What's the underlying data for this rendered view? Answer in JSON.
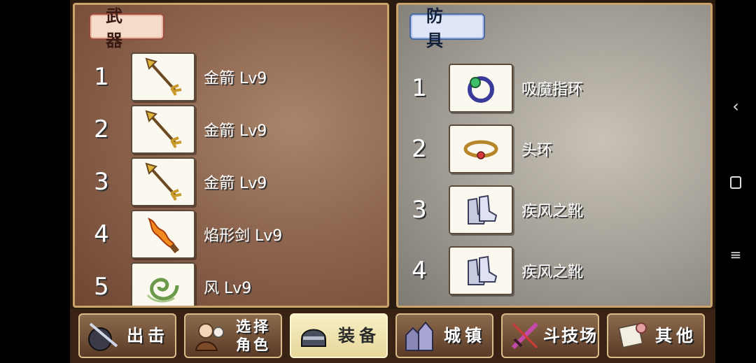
{
  "weapons": {
    "tab_label": "武器",
    "items": [
      {
        "num": "1",
        "name": "金箭 Lv9",
        "icon": "golden-arrow-icon"
      },
      {
        "num": "2",
        "name": "金箭 Lv9",
        "icon": "golden-arrow-icon"
      },
      {
        "num": "3",
        "name": "金箭 Lv9",
        "icon": "golden-arrow-icon"
      },
      {
        "num": "4",
        "name": "焰形剑 Lv9",
        "icon": "flame-sword-icon"
      },
      {
        "num": "5",
        "name": "风 Lv9",
        "icon": "wind-icon"
      }
    ]
  },
  "armor": {
    "tab_label": "防具",
    "items": [
      {
        "num": "1",
        "name": "吸魔指环",
        "icon": "magic-ring-icon"
      },
      {
        "num": "2",
        "name": "头环",
        "icon": "circlet-icon"
      },
      {
        "num": "3",
        "name": "疾风之靴",
        "icon": "boots-icon"
      },
      {
        "num": "4",
        "name": "疾风之靴",
        "icon": "boots-icon"
      }
    ]
  },
  "bottom_menu": [
    {
      "label": "出击",
      "icon": "sortie-icon",
      "active": false
    },
    {
      "label": "选择角色",
      "line1": "选择",
      "line2": "角色",
      "icon": "character-select-icon",
      "active": false
    },
    {
      "label": "装备",
      "icon": "helmet-icon",
      "active": true
    },
    {
      "label": "城镇",
      "icon": "town-icon",
      "active": false
    },
    {
      "label": "斗技场",
      "icon": "sword-arena-icon",
      "active": false
    },
    {
      "label": "其他",
      "icon": "scroll-icon",
      "active": false
    }
  ],
  "android_nav": {
    "icons": [
      "back-icon",
      "home-icon",
      "menu-icon"
    ]
  },
  "colors": {
    "weapon_panel": "#8e6650",
    "armor_panel": "#a9a49b",
    "frame": "#c9a36a",
    "active_button": "#f7efc6"
  }
}
